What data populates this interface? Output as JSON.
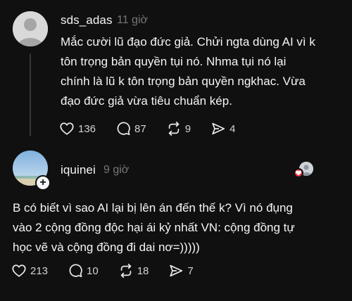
{
  "posts": [
    {
      "username": "sds_adas",
      "time": "11 giờ",
      "lines": [
        "Mắc cười lũ đạo đức giả. Chửi ngta dùng AI vì k",
        "tôn trọng bản quyền tụi nó. Nhma tụi nó lại",
        "chính là lũ k tôn trọng bản quyền ngkhac. Vừa",
        "đạo đức giả vừa tiêu chuẩn kép."
      ],
      "likes": "136",
      "comments": "87",
      "reposts": "9",
      "shares": "4"
    },
    {
      "username": "iquinei",
      "time": "9 giờ",
      "follow_symbol": "+",
      "lines": [
        "B có biết vì sao AI lại bị lên án đến thế k? Vì nó đụng",
        "vào 2 cộng đồng độc hại ái kỷ nhất VN: cộng đồng tự",
        "học vẽ và cộng đồng đi dai nơ=)))))"
      ],
      "likes": "213",
      "comments": "10",
      "reposts": "18",
      "shares": "7"
    }
  ],
  "icons": {
    "like": "heart-icon",
    "comment": "comment-icon",
    "repost": "repost-icon",
    "share": "share-icon"
  },
  "colors": {
    "background": "#101010",
    "text": "#f3f5f7",
    "muted": "#777777",
    "like_badge": "#ff3040"
  }
}
